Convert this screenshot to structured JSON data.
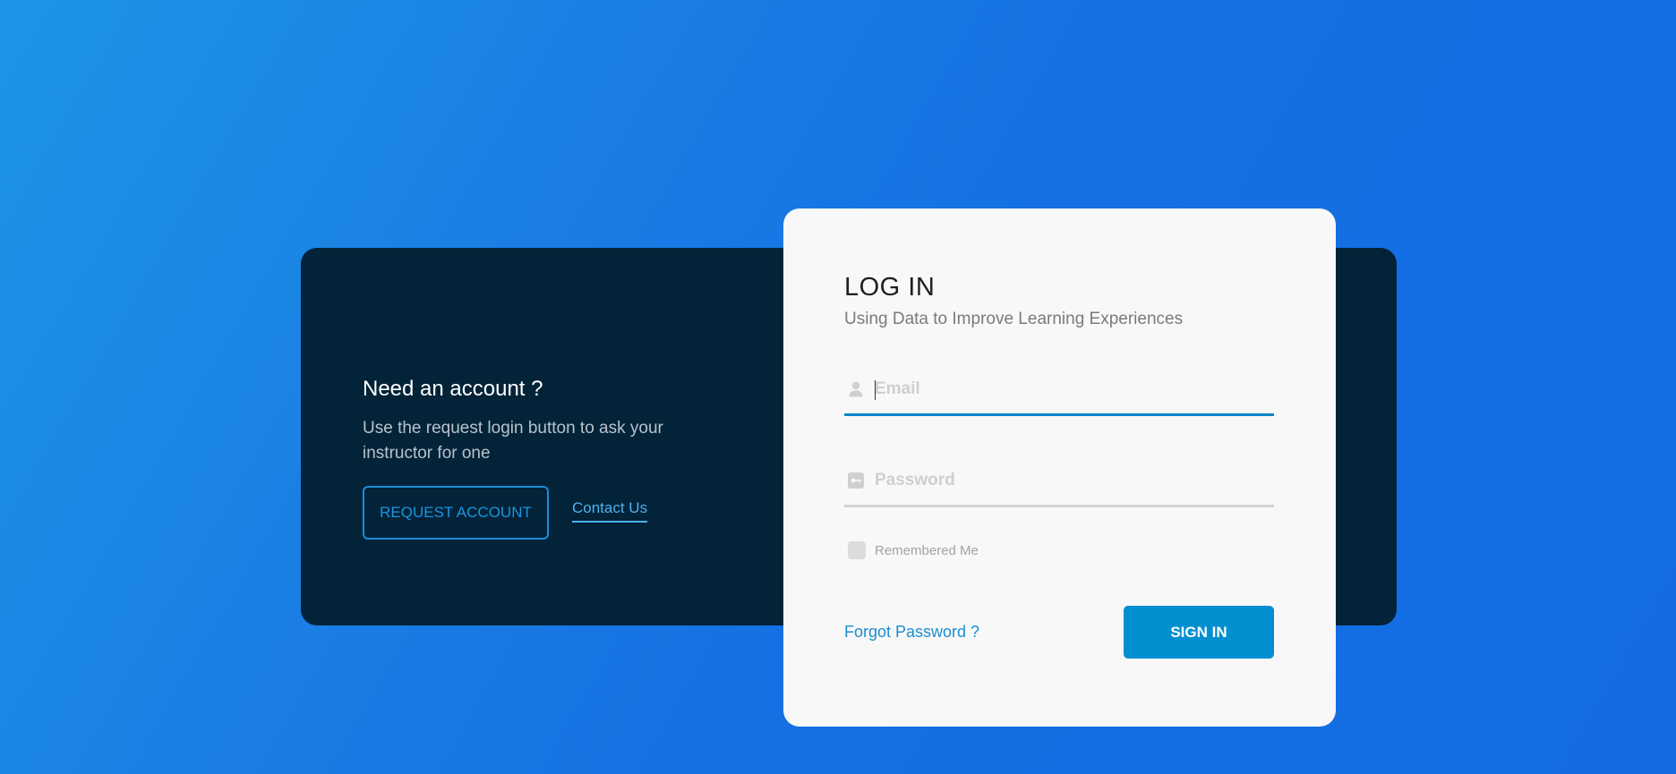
{
  "signup_panel": {
    "title": "Need an account ?",
    "description": "Use the request login button to ask your instructor for one",
    "request_button_label": "REQUEST ACCOUNT",
    "contact_link_label": "Contact Us"
  },
  "login": {
    "title": "LOG IN",
    "subtitle": "Using Data to Improve Learning Experiences",
    "email": {
      "placeholder": "Email",
      "value": "",
      "icon": "user-icon"
    },
    "password": {
      "placeholder": "Password",
      "value": "",
      "icon": "key-icon"
    },
    "remember_label": "Remembered Me",
    "remember_checked": false,
    "forgot_label": "Forgot Password ?",
    "submit_label": "SIGN IN"
  },
  "colors": {
    "background_start": "#1e95e6",
    "background_end": "#136ce3",
    "dark_panel": "#032338",
    "accent": "#028fd0",
    "card": "#f8f8f8"
  }
}
